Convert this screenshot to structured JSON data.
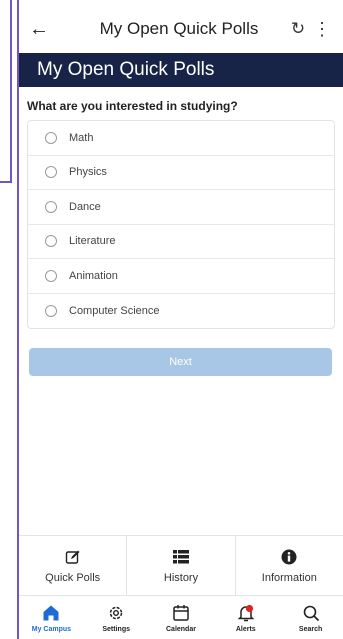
{
  "topbar": {
    "back_icon": "←",
    "title": "My Open Quick Polls",
    "refresh_icon": "↻",
    "more_icon": "⋮"
  },
  "header": {
    "title": "My Open Quick Polls"
  },
  "poll": {
    "question": "What are you interested in studying?",
    "options": [
      "Math",
      "Physics",
      "Dance",
      "Literature",
      "Animation",
      "Computer Science"
    ],
    "next_label": "Next"
  },
  "subtabs": [
    {
      "label": "Quick Polls",
      "icon": "edit-square-icon"
    },
    {
      "label": "History",
      "icon": "list-icon"
    },
    {
      "label": "Information",
      "icon": "info-icon"
    }
  ],
  "bottom_nav": [
    {
      "label": "My Campus",
      "icon": "home-icon",
      "active": true
    },
    {
      "label": "Settings",
      "icon": "gear-icon"
    },
    {
      "label": "Calendar",
      "icon": "calendar-icon"
    },
    {
      "label": "Alerts",
      "icon": "bell-icon"
    },
    {
      "label": "Search",
      "icon": "search-icon"
    }
  ],
  "colors": {
    "header_band": "#172448",
    "active_nav": "#1f6bd6",
    "next_button": "#a8c7e6",
    "alert_dot": "#e02424",
    "frame": "#6f55c8"
  }
}
